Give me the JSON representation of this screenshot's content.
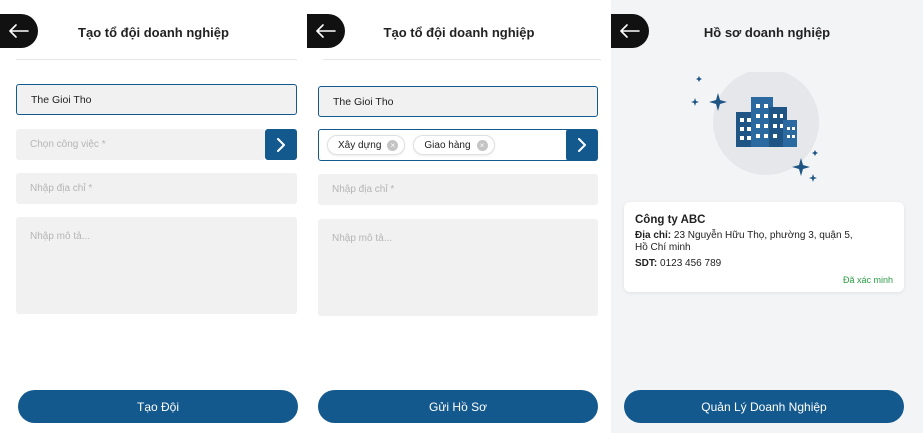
{
  "screens": [
    {
      "title": "Tạo tổ đội doanh nghiệp",
      "name_value": "The Gioi Tho",
      "job_placeholder": "Chọn công việc *",
      "address_placeholder": "Nhập địa chỉ *",
      "description_placeholder": "Nhập mô tả...",
      "primary_button": "Tạo Đội"
    },
    {
      "title": "Tạo tổ đội doanh nghiệp",
      "name_value": "The Gioi Tho",
      "job_tags": [
        "Xây dựng",
        "Giao hàng"
      ],
      "address_placeholder": "Nhập địa chỉ *",
      "description_placeholder": "Nhập mô tả...",
      "primary_button": "Gửi Hồ Sơ"
    },
    {
      "title": "Hồ sơ doanh nghiệp",
      "company_name": "Công ty ABC",
      "address_label": "Địa chỉ:",
      "address_line1": "23 Nguyễn Hữu Thọ, phường 3, quận 5,",
      "address_line2": "Hồ Chí minh",
      "phone_label": "SDT:",
      "phone_value": "0123 456 789",
      "verified_label": "Đã xác minh",
      "primary_button": "Quản Lý Doanh Nghiệp"
    }
  ],
  "icons": {
    "back": "arrow-left-icon",
    "next": "chevron-right-icon",
    "chip_remove": "close-circle-icon",
    "illustration": "buildings-icon",
    "sparkle": "sparkle-icon"
  },
  "colors": {
    "primary": "#14598e",
    "back_button": "#111111",
    "verified": "#2a9d45",
    "field_bg": "#f1f1f1"
  }
}
